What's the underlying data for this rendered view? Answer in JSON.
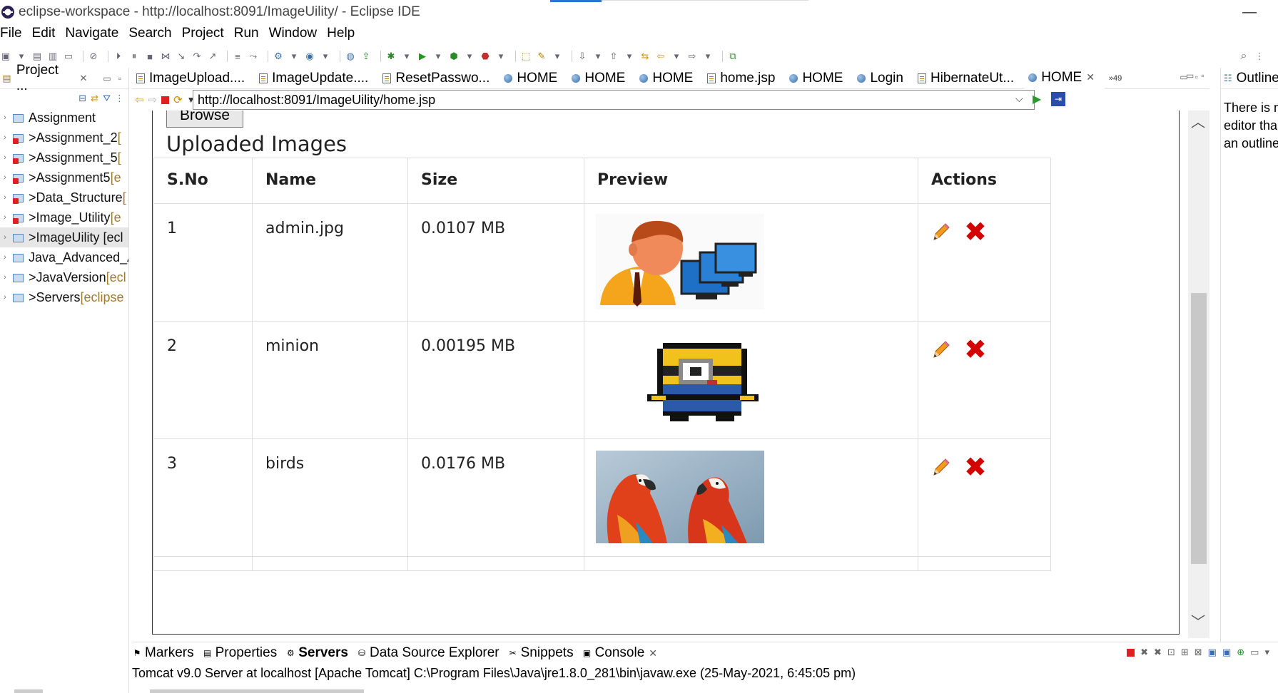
{
  "window": {
    "title": "eclipse-workspace - http://localhost:8091/ImageUility/ - Eclipse IDE",
    "minimize": "—"
  },
  "menu": [
    "File",
    "Edit",
    "Navigate",
    "Search",
    "Project",
    "Run",
    "Window",
    "Help"
  ],
  "project_explorer": {
    "tab_label": "Project ...",
    "items": [
      {
        "name": "Assignment",
        "prefix": "",
        "decor": "",
        "error": false,
        "selected": false
      },
      {
        "name": "Assignment_2",
        "prefix": "> ",
        "decor": " [",
        "error": true,
        "selected": false
      },
      {
        "name": "Assignment_5",
        "prefix": "> ",
        "decor": " [",
        "error": true,
        "selected": false
      },
      {
        "name": "Assignment5",
        "prefix": "> ",
        "decor": " [e",
        "error": true,
        "selected": false
      },
      {
        "name": "Data_Structure",
        "prefix": "> ",
        "decor": " [",
        "error": true,
        "selected": false
      },
      {
        "name": "Image_Utility",
        "prefix": "> ",
        "decor": " [e",
        "error": true,
        "selected": false
      },
      {
        "name": "ImageUility [ecl",
        "prefix": "> ",
        "decor": "",
        "error": false,
        "selected": true
      },
      {
        "name": "Java_Advanced_A",
        "prefix": "",
        "decor": "",
        "error": false,
        "selected": false
      },
      {
        "name": "JavaVersion",
        "prefix": "> ",
        "decor": " [ecl",
        "error": false,
        "selected": false
      },
      {
        "name": "Servers",
        "prefix": "> ",
        "decor": " [eclipse",
        "error": false,
        "selected": false
      }
    ]
  },
  "editor_tabs": [
    {
      "label": "ImageUpload....",
      "icon": "jsp-file-icon",
      "active": false
    },
    {
      "label": "ImageUpdate....",
      "icon": "jsp-file-icon",
      "active": false
    },
    {
      "label": "ResetPasswo...",
      "icon": "jsp-file-icon",
      "active": false
    },
    {
      "label": "HOME",
      "icon": "globe-icon",
      "active": false
    },
    {
      "label": "HOME",
      "icon": "globe-icon",
      "active": false
    },
    {
      "label": "HOME",
      "icon": "globe-icon",
      "active": false
    },
    {
      "label": "home.jsp",
      "icon": "jsp-file-icon",
      "active": false
    },
    {
      "label": "HOME",
      "icon": "globe-icon",
      "active": false
    },
    {
      "label": "Login",
      "icon": "globe-icon",
      "active": false
    },
    {
      "label": "HibernateUt...",
      "icon": "jsp-file-icon",
      "active": false
    },
    {
      "label": "HOME",
      "icon": "globe-icon",
      "active": true
    }
  ],
  "tabs_overflow": "»49",
  "browser": {
    "url": "http://localhost:8091/ImageUility/home.jsp"
  },
  "page": {
    "browse_label": "Browse",
    "section_title": "Uploaded Images",
    "table": {
      "headers": [
        "S.No",
        "Name",
        "Size",
        "Preview",
        "Actions"
      ],
      "rows": [
        {
          "sno": "1",
          "name": "admin.jpg",
          "size": "0.0107 MB",
          "preview": "admin-user-computer-image"
        },
        {
          "sno": "2",
          "name": "minion",
          "size": "0.00195 MB",
          "preview": "pixel-minion-image"
        },
        {
          "sno": "3",
          "name": "birds",
          "size": "0.0176 MB",
          "preview": "two-macaw-parrots-image"
        }
      ],
      "delete_glyph": "✖"
    }
  },
  "outline": {
    "tab_label": "Outline",
    "message_lines": [
      "There is n",
      "editor tha",
      "an outline"
    ]
  },
  "bottom_views": {
    "tabs": [
      {
        "label": "Markers",
        "icon": "markers-icon",
        "bold": false
      },
      {
        "label": "Properties",
        "icon": "properties-icon",
        "bold": false
      },
      {
        "label": "Servers",
        "icon": "servers-icon",
        "bold": true
      },
      {
        "label": "Data Source Explorer",
        "icon": "data-source-icon",
        "bold": false
      },
      {
        "label": "Snippets",
        "icon": "snippets-icon",
        "bold": false
      },
      {
        "label": "Console",
        "icon": "console-icon",
        "bold": false,
        "closable": true
      }
    ],
    "console_text": "Tomcat v9.0 Server at localhost [Apache Tomcat] C:\\Program Files\\Java\\jre1.8.0_281\\bin\\javaw.exe  (25-May-2021, 6:45:05 pm)"
  },
  "colors": {
    "accent_blue": "#2d73d6",
    "delete_red": "#d40000",
    "selection_gray": "#e6e6e6",
    "error_red": "#e02020"
  }
}
